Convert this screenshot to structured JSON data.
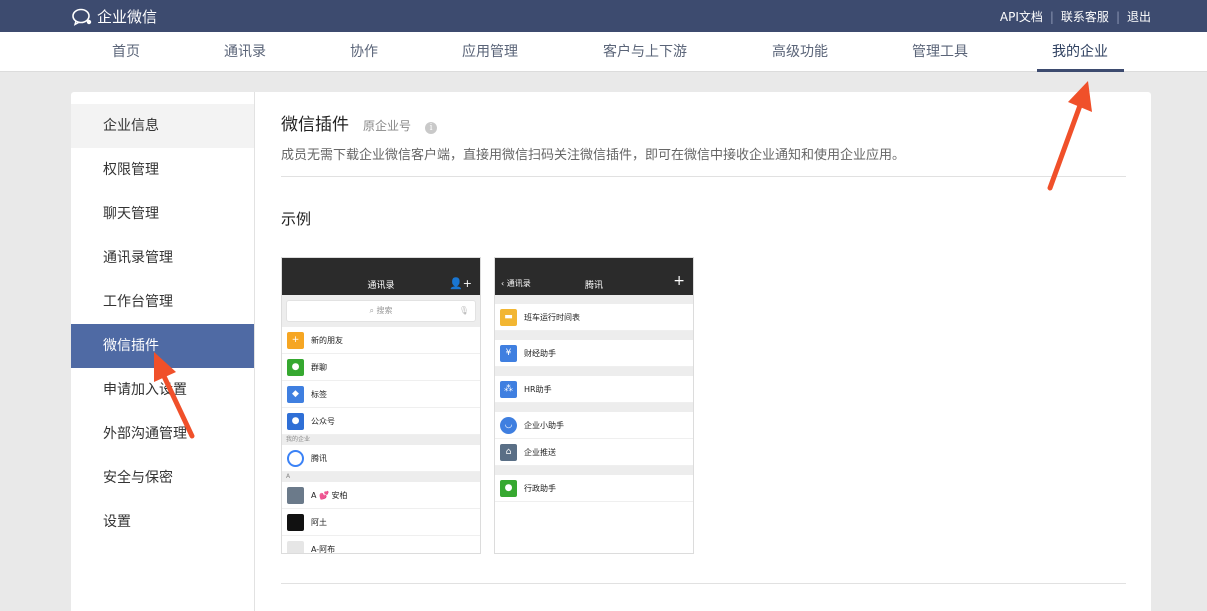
{
  "header": {
    "logo_text": "企业微信",
    "links": [
      "API文档",
      "联系客服",
      "退出"
    ]
  },
  "nav": {
    "items": [
      "首页",
      "通讯录",
      "协作",
      "应用管理",
      "客户与上下游",
      "高级功能",
      "管理工具",
      "我的企业"
    ],
    "active": "我的企业"
  },
  "sidebar": {
    "items": [
      "企业信息",
      "权限管理",
      "聊天管理",
      "通讯录管理",
      "工作台管理",
      "微信插件",
      "申请加入设置",
      "外部沟通管理",
      "安全与保密",
      "设置"
    ],
    "active": "微信插件"
  },
  "main": {
    "title": "微信插件",
    "subtitle": "原企业号",
    "description": "成员无需下载企业微信客户端，直接用微信扫码关注微信插件，即可在微信中接收企业通知和使用企业应用。",
    "example_heading": "示例"
  },
  "phone1": {
    "title": "通讯录",
    "search_placeholder": "搜索",
    "rows": [
      "新的朋友",
      "群聊",
      "标签",
      "公众号"
    ],
    "section_label": "我的企业",
    "company_row": "腾讯",
    "letter_label": "A",
    "contacts": [
      "A 💕 安柏",
      "阿土",
      "A-阿布"
    ]
  },
  "phone2": {
    "back_label": "通讯录",
    "title": "腾讯",
    "rows": [
      "班车运行时间表",
      "财经助手",
      "HR助手",
      "企业小助手",
      "企业推送",
      "行政助手"
    ]
  },
  "colors": {
    "topbar": "#3d4b6f",
    "sidebar_active": "#4f6aa4",
    "arrow": "#f0502a"
  }
}
